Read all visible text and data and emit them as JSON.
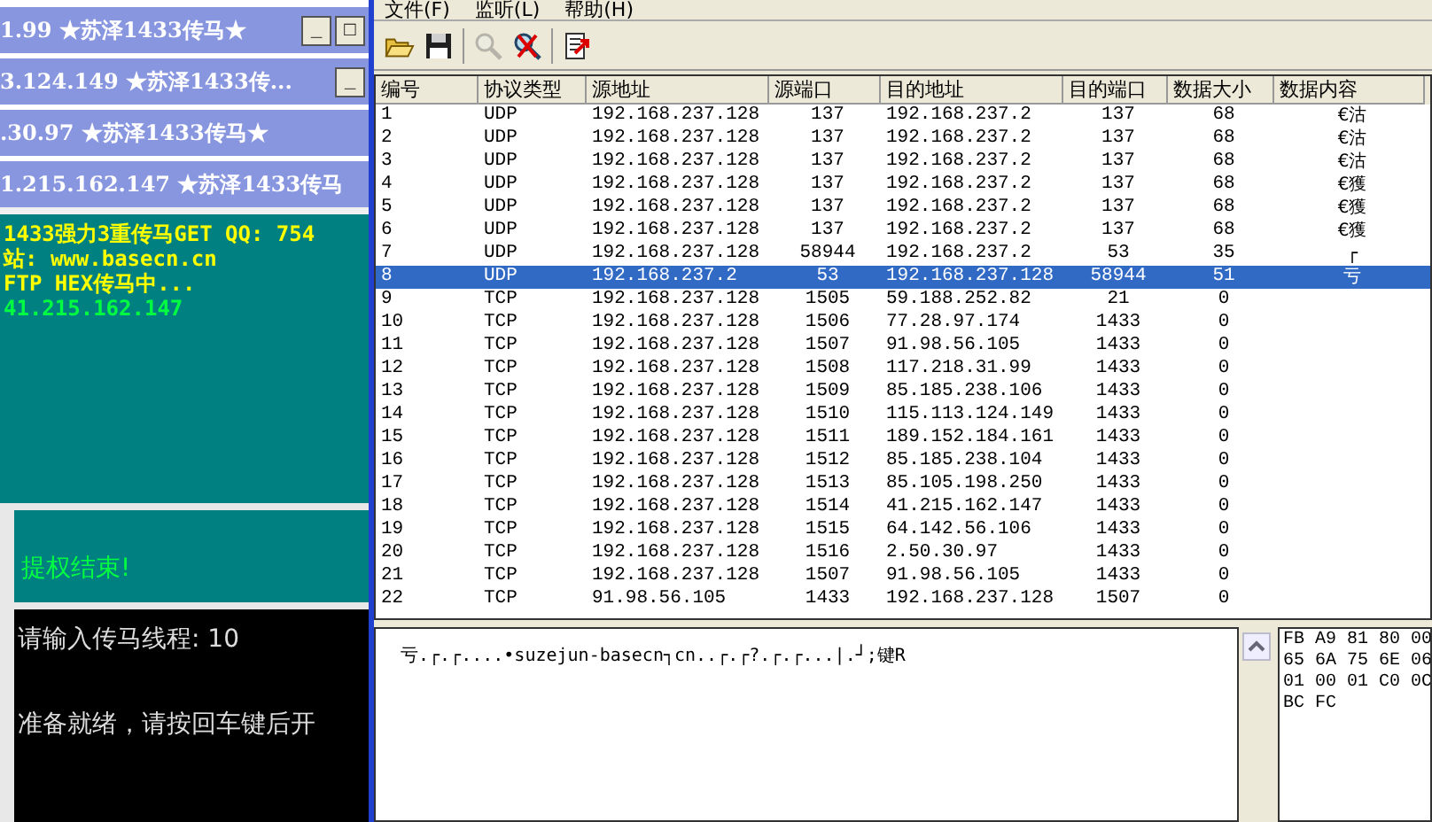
{
  "left_windows": [
    {
      "title": "1.99 ★苏泽1433传马★",
      "buttons": [
        "_",
        "□"
      ]
    },
    {
      "title": "3.124.149 ★苏泽1433传...",
      "buttons": [
        "_"
      ]
    },
    {
      "title": ".30.97 ★苏泽1433传马★"
    },
    {
      "title": "1.215.162.147 ★苏泽1433传马"
    }
  ],
  "log_lines": [
    {
      "text": "1433强力3重传马GET QQ: 754",
      "kind": "notice"
    },
    {
      "text": "站: www.basecn.cn",
      "kind": "notice"
    },
    {
      "text": "FTP HEX传马中...",
      "kind": "notice"
    },
    {
      "text": "41.215.162.147",
      "kind": "ok"
    }
  ],
  "status_message": "提权结束!",
  "console_lines": [
    "请输入传马线程: 10",
    "准备就绪，请按回车键后开"
  ],
  "menu": [
    "文件(F)",
    "监听(L)",
    "帮助(H)"
  ],
  "toolbar": [
    {
      "kind": "open",
      "disabled": false
    },
    {
      "kind": "save",
      "disabled": false
    },
    {
      "kind": "search",
      "disabled": true
    },
    {
      "kind": "stop",
      "disabled": false
    },
    {
      "kind": "export",
      "disabled": false
    }
  ],
  "table": {
    "columns": [
      "编号",
      "协议类型",
      "源地址",
      "源端口",
      "目的地址",
      "目的端口",
      "数据大小",
      "数据内容"
    ],
    "rows": [
      {
        "cells": [
          "1",
          "UDP",
          "192.168.237.128",
          "137",
          "192.168.237.2",
          "137",
          "68",
          "€沽"
        ],
        "selected": false
      },
      {
        "cells": [
          "2",
          "UDP",
          "192.168.237.128",
          "137",
          "192.168.237.2",
          "137",
          "68",
          "€沽"
        ],
        "selected": false
      },
      {
        "cells": [
          "3",
          "UDP",
          "192.168.237.128",
          "137",
          "192.168.237.2",
          "137",
          "68",
          "€沽"
        ],
        "selected": false
      },
      {
        "cells": [
          "4",
          "UDP",
          "192.168.237.128",
          "137",
          "192.168.237.2",
          "137",
          "68",
          "€獲"
        ],
        "selected": false
      },
      {
        "cells": [
          "5",
          "UDP",
          "192.168.237.128",
          "137",
          "192.168.237.2",
          "137",
          "68",
          "€獲"
        ],
        "selected": false
      },
      {
        "cells": [
          "6",
          "UDP",
          "192.168.237.128",
          "137",
          "192.168.237.2",
          "137",
          "68",
          "€獲"
        ],
        "selected": false
      },
      {
        "cells": [
          "7",
          "UDP",
          "192.168.237.128",
          "58944",
          "192.168.237.2",
          "53",
          "35",
          "┌"
        ],
        "selected": false
      },
      {
        "cells": [
          "8",
          "UDP",
          "192.168.237.2",
          "53",
          "192.168.237.128",
          "58944",
          "51",
          "亏"
        ],
        "selected": true
      },
      {
        "cells": [
          "9",
          "TCP",
          "192.168.237.128",
          "1505",
          "59.188.252.82",
          "21",
          "0"
        ],
        "selected": false
      },
      {
        "cells": [
          "10",
          "TCP",
          "192.168.237.128",
          "1506",
          "77.28.97.174",
          "1433",
          "0"
        ],
        "selected": false
      },
      {
        "cells": [
          "11",
          "TCP",
          "192.168.237.128",
          "1507",
          "91.98.56.105",
          "1433",
          "0"
        ],
        "selected": false
      },
      {
        "cells": [
          "12",
          "TCP",
          "192.168.237.128",
          "1508",
          "117.218.31.99",
          "1433",
          "0"
        ],
        "selected": false
      },
      {
        "cells": [
          "13",
          "TCP",
          "192.168.237.128",
          "1509",
          "85.185.238.106",
          "1433",
          "0"
        ],
        "selected": false
      },
      {
        "cells": [
          "14",
          "TCP",
          "192.168.237.128",
          "1510",
          "115.113.124.149",
          "1433",
          "0"
        ],
        "selected": false
      },
      {
        "cells": [
          "15",
          "TCP",
          "192.168.237.128",
          "1511",
          "189.152.184.161",
          "1433",
          "0"
        ],
        "selected": false
      },
      {
        "cells": [
          "16",
          "TCP",
          "192.168.237.128",
          "1512",
          "85.185.238.104",
          "1433",
          "0"
        ],
        "selected": false
      },
      {
        "cells": [
          "17",
          "TCP",
          "192.168.237.128",
          "1513",
          "85.105.198.250",
          "1433",
          "0"
        ],
        "selected": false
      },
      {
        "cells": [
          "18",
          "TCP",
          "192.168.237.128",
          "1514",
          "41.215.162.147",
          "1433",
          "0"
        ],
        "selected": false
      },
      {
        "cells": [
          "19",
          "TCP",
          "192.168.237.128",
          "1515",
          "64.142.56.106",
          "1433",
          "0"
        ],
        "selected": false
      },
      {
        "cells": [
          "20",
          "TCP",
          "192.168.237.128",
          "1516",
          "2.50.30.97",
          "1433",
          "0"
        ],
        "selected": false
      },
      {
        "cells": [
          "21",
          "TCP",
          "192.168.237.128",
          "1507",
          "91.98.56.105",
          "1433",
          "0"
        ],
        "selected": false
      },
      {
        "cells": [
          "22",
          "TCP",
          "91.98.56.105",
          "1433",
          "192.168.237.128",
          "1507",
          "0"
        ],
        "selected": false
      }
    ]
  },
  "packet_text": "亏.┌.┌....•suzejun-basecn┐cn..┌.┌?.┌.┌...|.┘;键R",
  "hex_lines": [
    "FB A9 81 80 00",
    "65 6A 75 6E 06",
    "01 00 01 C0 0C",
    "BC FC"
  ]
}
